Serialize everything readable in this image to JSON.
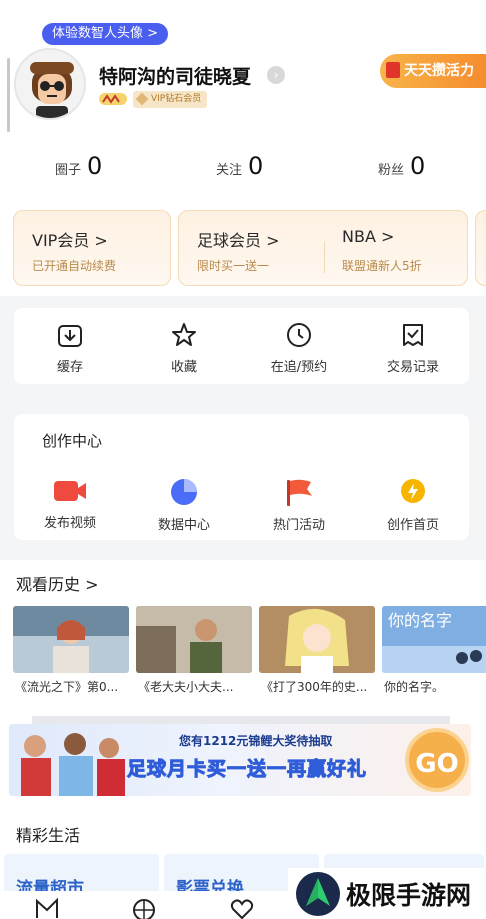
{
  "profile": {
    "avatar_badge": "体验数智人头像 >",
    "username": "特阿沟的司徒晓夏",
    "vip_level": "VIP钻石会员",
    "vitality_button": "天天攒活力"
  },
  "stats": [
    {
      "label": "圈子",
      "value": "0"
    },
    {
      "label": "关注",
      "value": "0"
    },
    {
      "label": "粉丝",
      "value": "0"
    }
  ],
  "memberships": [
    {
      "title": "VIP会员 >",
      "subtitle": "已开通自动续费"
    },
    {
      "title": "足球会员 >",
      "subtitle": "限时买一送一"
    },
    {
      "title": "NBA >",
      "subtitle": "联盟通新人5折"
    }
  ],
  "quick_actions": [
    {
      "label": "缓存",
      "icon": "download-icon"
    },
    {
      "label": "收藏",
      "icon": "star-icon"
    },
    {
      "label": "在追/预约",
      "icon": "clock-icon"
    },
    {
      "label": "交易记录",
      "icon": "receipt-icon"
    }
  ],
  "creator_center": {
    "title": "创作中心",
    "items": [
      {
        "label": "发布视频",
        "icon": "video-camera-icon",
        "color": "#f04a3e"
      },
      {
        "label": "数据中心",
        "icon": "pie-chart-icon",
        "color": "#4a6cf7"
      },
      {
        "label": "热门活动",
        "icon": "flag-icon",
        "color": "#f25a3a"
      },
      {
        "label": "创作首页",
        "icon": "lightning-icon",
        "color": "#f7b500"
      }
    ]
  },
  "history": {
    "title": "观看历史 >",
    "items": [
      {
        "caption": "《流光之下》第0..."
      },
      {
        "caption": "《老大夫小大夫..."
      },
      {
        "caption": "《打了300年的史..."
      },
      {
        "caption": "你的名字。"
      }
    ]
  },
  "banner": {
    "top_text": "您有1212元锦鲤大奖待抽取",
    "main_text": "足球月卡买一送一再赢好礼",
    "go_label": "GO"
  },
  "life": {
    "title": "精彩生活",
    "items": [
      {
        "label": "流量超市"
      },
      {
        "label": "影票兑换"
      }
    ]
  },
  "watermark": {
    "text": "极限手游网"
  },
  "colors": {
    "accent_blue": "#4a5ef0",
    "vitality_orange": "#f5952f",
    "member_gold": "#b98a4d"
  }
}
